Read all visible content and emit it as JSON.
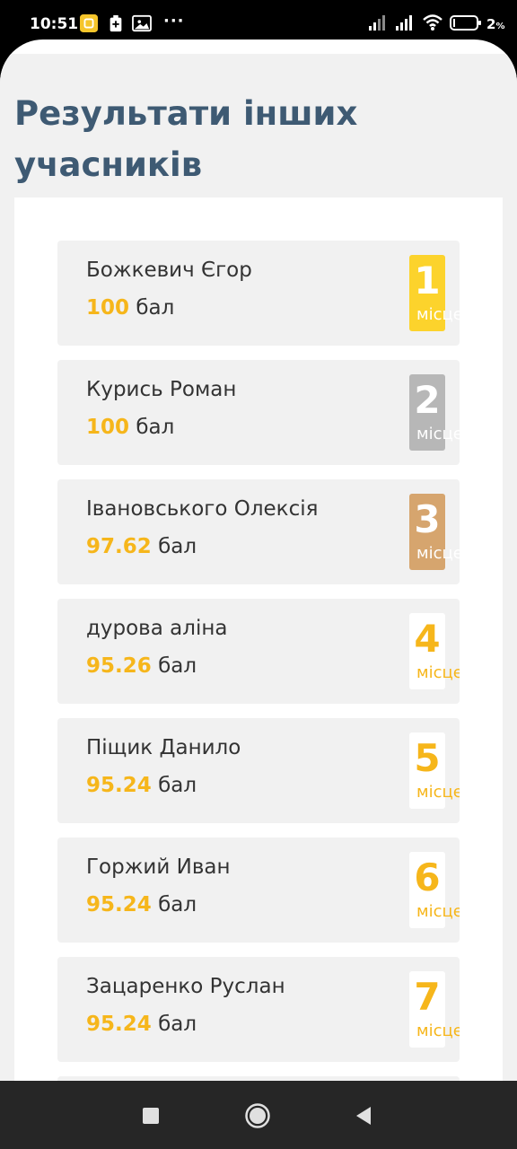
{
  "status_bar": {
    "time": "10:51",
    "more": "···",
    "battery_text": "2",
    "battery_unit": "%"
  },
  "page": {
    "title": "Результати інших учасників"
  },
  "results": [
    {
      "name": "Божкевич Єгор",
      "score": "100",
      "unit": "бал",
      "place": "1",
      "place_label": "місце"
    },
    {
      "name": "Курись Роман",
      "score": "100",
      "unit": "бал",
      "place": "2",
      "place_label": "місце"
    },
    {
      "name": "Івановського Олексія",
      "score": "97.62",
      "unit": "бал",
      "place": "3",
      "place_label": "місце"
    },
    {
      "name": "дурова аліна",
      "score": "95.26",
      "unit": "бал",
      "place": "4",
      "place_label": "місце"
    },
    {
      "name": "Піщик Данило",
      "score": "95.24",
      "unit": "бал",
      "place": "5",
      "place_label": "місце"
    },
    {
      "name": "Горжий Иван",
      "score": "95.24",
      "unit": "бал",
      "place": "6",
      "place_label": "місце"
    },
    {
      "name": "Зацаренко Руслан",
      "score": "95.24",
      "unit": "бал",
      "place": "7",
      "place_label": "місце"
    }
  ],
  "colors": {
    "title": "#3e5a73",
    "score_accent": "#f6b61b",
    "gold": "#fcd32c",
    "silver": "#b7b7b7",
    "bronze": "#d6a56e",
    "card_bg": "#f1f1f1"
  },
  "icons": {
    "status_left": [
      "notification-app-icon",
      "battery-saver-icon",
      "gallery-icon"
    ],
    "status_right": [
      "signal-icon",
      "signal-icon",
      "wifi-icon",
      "battery-icon"
    ],
    "nav": [
      "recents-icon",
      "home-icon",
      "back-icon"
    ]
  }
}
